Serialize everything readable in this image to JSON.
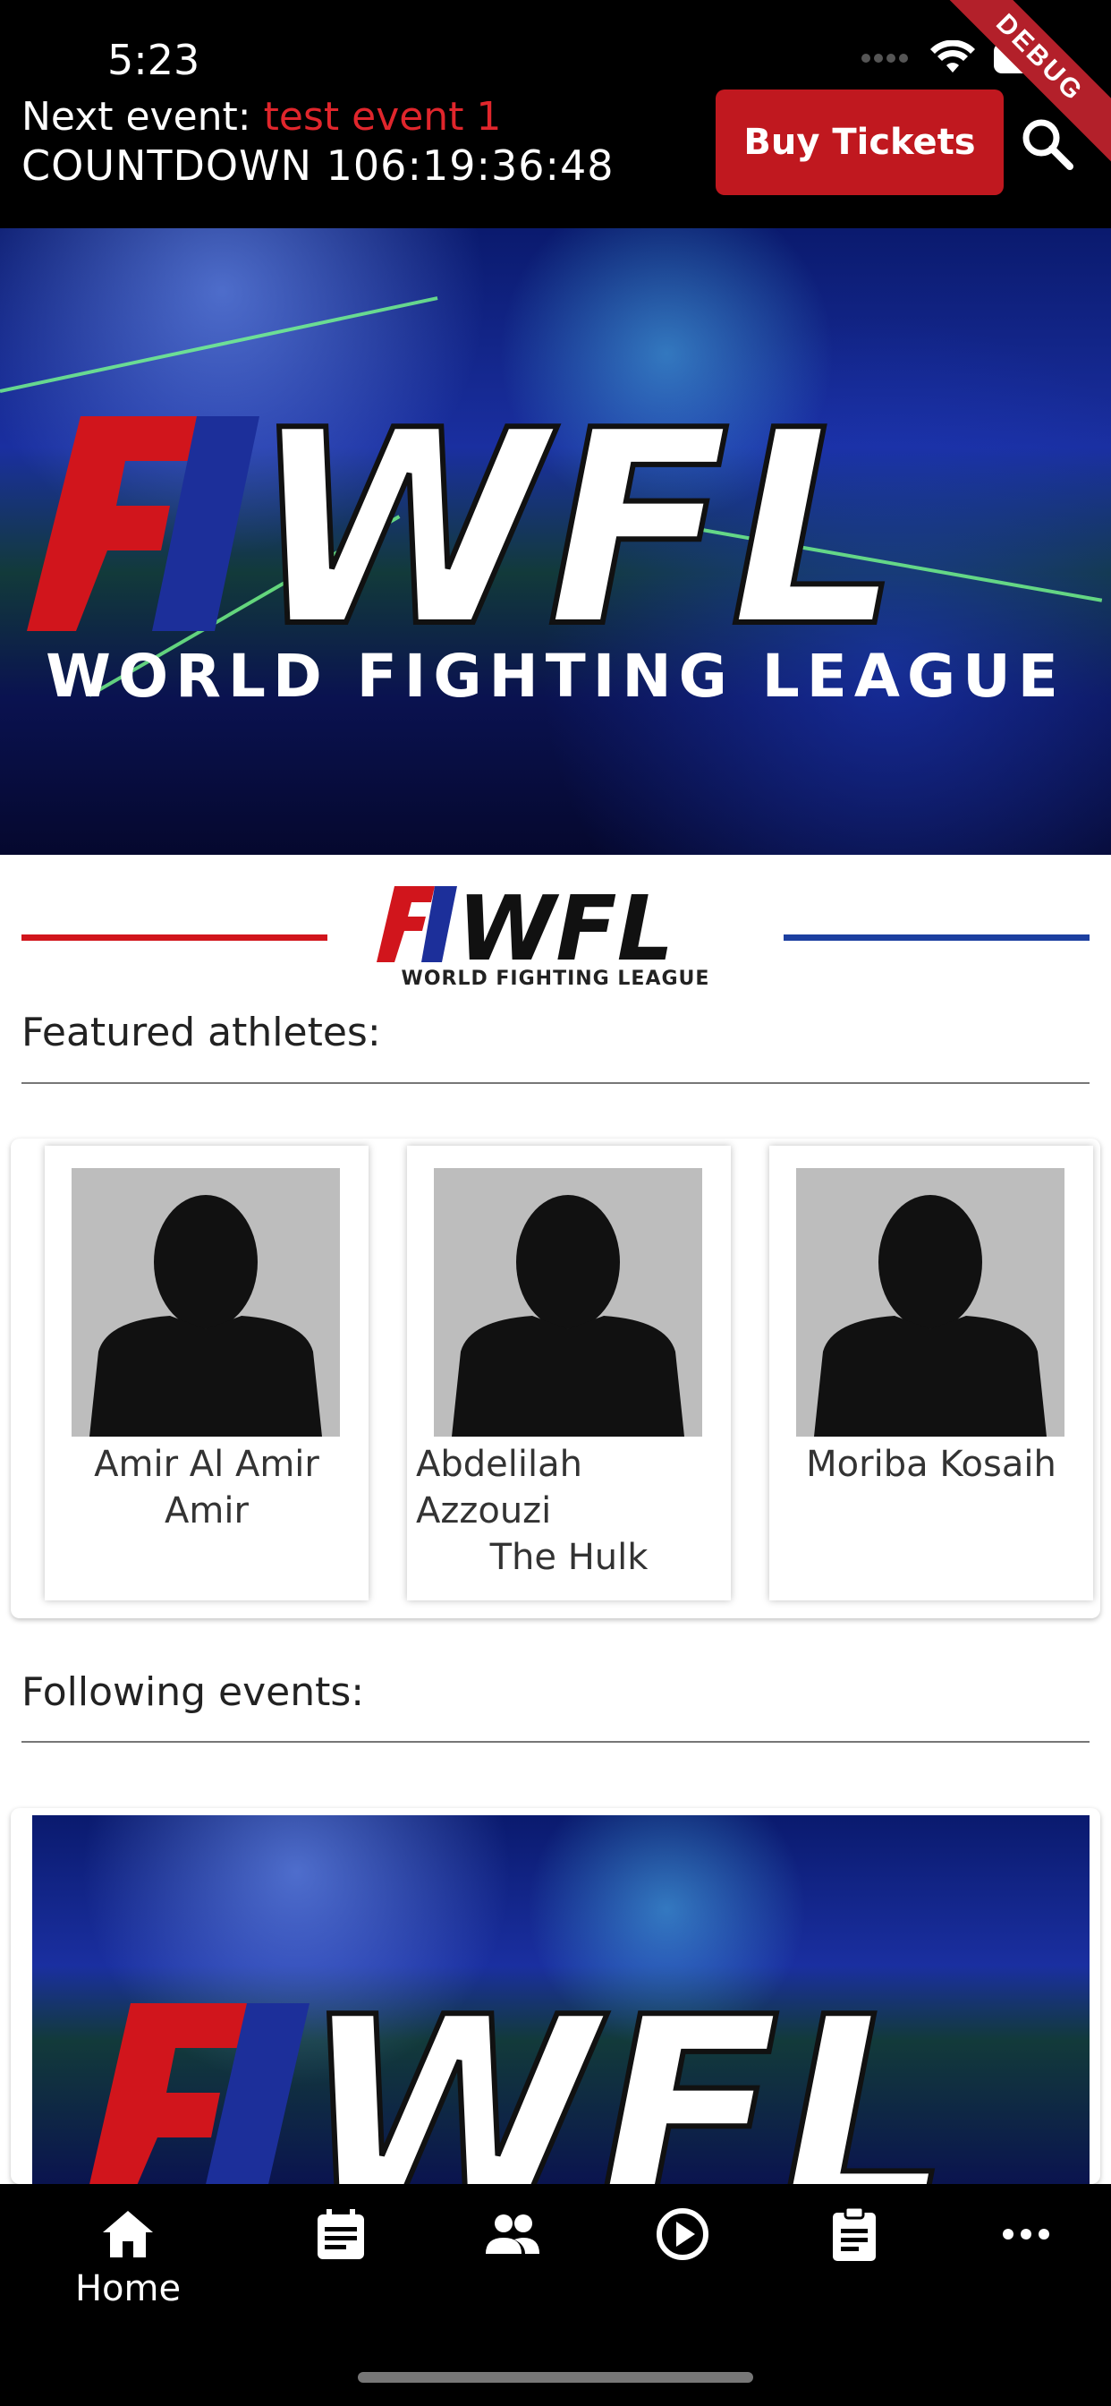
{
  "status_bar": {
    "time": "5:23",
    "debug_label": "DEBUG"
  },
  "header": {
    "next_event_prefix": "Next event:",
    "next_event_name": "test event 1",
    "countdown": "COUNTDOWN 106:19:36:48",
    "buy_tickets_label": "Buy Tickets"
  },
  "hero": {
    "league_abbrev": "WFL",
    "league_name": "WORLD FIGHTING LEAGUE"
  },
  "brand": {
    "abbrev": "WFL",
    "name": "WORLD FIGHTING LEAGUE"
  },
  "featured": {
    "title": "Featured athletes:",
    "athletes": [
      {
        "name_line1": "Amir Al Amir",
        "name_line2": "Amir",
        "nickname": ""
      },
      {
        "name_line1": "Abdelilah",
        "name_line2": "Azzouzi",
        "nickname": "The Hulk"
      },
      {
        "name_line1": "Moriba Kosaih",
        "name_line2": "",
        "nickname": ""
      }
    ]
  },
  "following": {
    "title": "Following events:"
  },
  "tabbar": {
    "items": [
      {
        "icon": "home-icon",
        "label": "Home"
      },
      {
        "icon": "calendar-icon",
        "label": ""
      },
      {
        "icon": "people-icon",
        "label": ""
      },
      {
        "icon": "play-circle-icon",
        "label": ""
      },
      {
        "icon": "clipboard-icon",
        "label": ""
      },
      {
        "icon": "more-icon",
        "label": ""
      }
    ]
  },
  "colors": {
    "accent_red": "#c0181f",
    "brand_blue": "#1c3fa0",
    "background": "#000000"
  }
}
